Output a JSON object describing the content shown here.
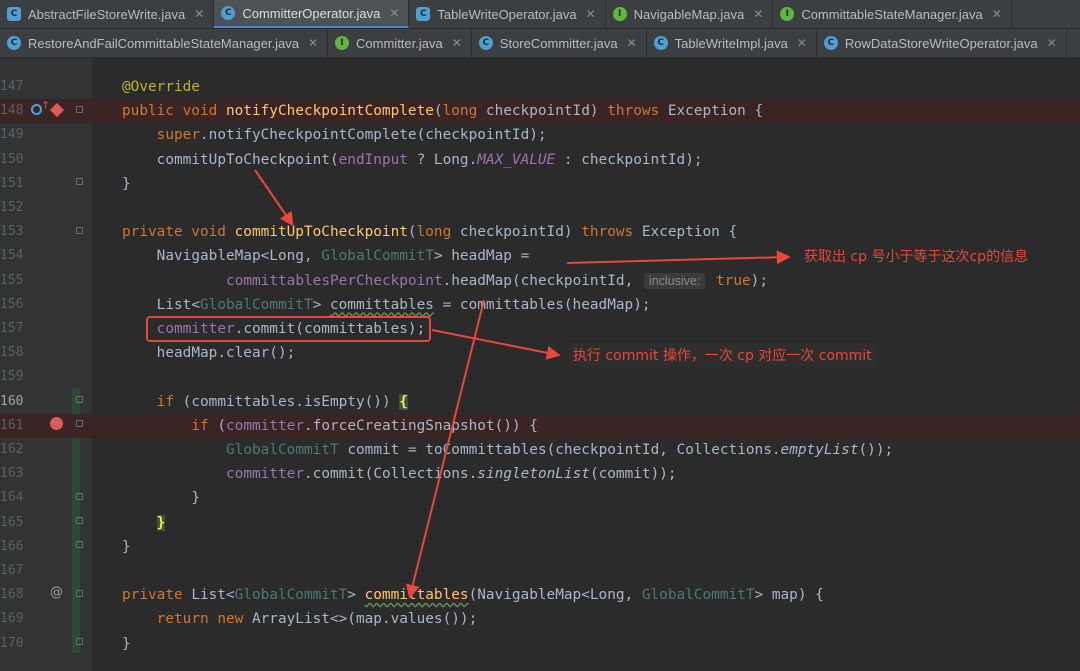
{
  "tabs_row1": [
    {
      "label": "AbstractFileStoreWrite.java",
      "icon": "abstract-class-icon",
      "kind": "abstract",
      "active": false
    },
    {
      "label": "CommitterOperator.java",
      "icon": "class-icon",
      "kind": "class",
      "active": true
    },
    {
      "label": "TableWriteOperator.java",
      "icon": "abstract-class-icon",
      "kind": "abstract",
      "active": false
    },
    {
      "label": "NavigableMap.java",
      "icon": "interface-icon",
      "kind": "iface",
      "active": false
    },
    {
      "label": "CommittableStateManager.java",
      "icon": "interface-icon",
      "kind": "iface",
      "active": false
    }
  ],
  "tabs_row2": [
    {
      "label": "RestoreAndFailCommittableStateManager.java",
      "icon": "class-icon",
      "kind": "class",
      "active": false
    },
    {
      "label": "Committer.java",
      "icon": "interface-icon",
      "kind": "iface",
      "active": false
    },
    {
      "label": "StoreCommitter.java",
      "icon": "class-icon",
      "kind": "class",
      "active": false
    },
    {
      "label": "TableWriteImpl.java",
      "icon": "class-icon",
      "kind": "class",
      "active": false
    },
    {
      "label": "RowDataStoreWriteOperator.java",
      "icon": "class-icon",
      "kind": "class",
      "active": false
    }
  ],
  "editor": {
    "lines": [
      {
        "n": "147",
        "indent": 0,
        "tokens": [
          {
            "t": "@Override",
            "c": "ann"
          }
        ]
      },
      {
        "n": "148",
        "indent": 0,
        "bp": true,
        "tokens": [
          {
            "t": "public void ",
            "c": "kw"
          },
          {
            "t": "notifyCheckpointComplete",
            "c": "fn"
          },
          {
            "t": "("
          },
          {
            "t": "long ",
            "c": "kw"
          },
          {
            "t": "checkpointId) "
          },
          {
            "t": "throws ",
            "c": "kw"
          },
          {
            "t": "Exception {"
          }
        ]
      },
      {
        "n": "149",
        "indent": 4,
        "tokens": [
          {
            "t": "super",
            "c": "kw"
          },
          {
            "t": ".notifyCheckpointComplete(checkpointId);"
          }
        ]
      },
      {
        "n": "150",
        "indent": 4,
        "tokens": [
          {
            "t": "commitUpToCheckpoint("
          },
          {
            "t": "endInput",
            "c": "fld"
          },
          {
            "t": " ? Long."
          },
          {
            "t": "MAX_VALUE",
            "c": "const"
          },
          {
            "t": " : checkpointId);"
          }
        ]
      },
      {
        "n": "151",
        "indent": 0,
        "tokens": [
          {
            "t": "}"
          }
        ]
      },
      {
        "n": "152",
        "indent": 0,
        "tokens": []
      },
      {
        "n": "153",
        "indent": 0,
        "tokens": [
          {
            "t": "private void ",
            "c": "kw"
          },
          {
            "t": "commitUpToCheckpoint",
            "c": "fn"
          },
          {
            "t": "("
          },
          {
            "t": "long ",
            "c": "kw"
          },
          {
            "t": "checkpointId) "
          },
          {
            "t": "throws ",
            "c": "kw"
          },
          {
            "t": "Exception {"
          }
        ]
      },
      {
        "n": "154",
        "indent": 4,
        "tokens": [
          {
            "t": "NavigableMap<Long, "
          },
          {
            "t": "GlobalCommitT",
            "c": "gen"
          },
          {
            "t": "> headMap ="
          }
        ]
      },
      {
        "n": "155",
        "indent": 12,
        "tokens": [
          {
            "t": "committablesPerCheckpoint",
            "c": "fld"
          },
          {
            "t": ".headMap(checkpointId, "
          },
          {
            "t": "inclusive:",
            "c": "hint"
          },
          {
            "t": " "
          },
          {
            "t": "true",
            "c": "kw"
          },
          {
            "t": ");"
          }
        ]
      },
      {
        "n": "156",
        "indent": 4,
        "tokens": [
          {
            "t": "List<"
          },
          {
            "t": "GlobalCommitT",
            "c": "gen"
          },
          {
            "t": "> "
          },
          {
            "t": "committables",
            "c": "wavy"
          },
          {
            "t": " = committables(headMap);"
          }
        ]
      },
      {
        "n": "157",
        "indent": 4,
        "tokens": [
          {
            "t": "committer",
            "c": "fld"
          },
          {
            "t": ".commit(committables);"
          }
        ]
      },
      {
        "n": "158",
        "indent": 4,
        "tokens": [
          {
            "t": "headMap.clear();"
          }
        ]
      },
      {
        "n": "159",
        "indent": 0,
        "tokens": []
      },
      {
        "n": "160",
        "indent": 4,
        "current": true,
        "tokens": [
          {
            "t": "if ",
            "c": "kw"
          },
          {
            "t": "(committables.isEmpty()) "
          },
          {
            "t": "{",
            "c": "brace-hl"
          }
        ]
      },
      {
        "n": "161",
        "indent": 8,
        "bp": true,
        "tokens": [
          {
            "t": "if ",
            "c": "kw"
          },
          {
            "t": "("
          },
          {
            "t": "committer",
            "c": "fld"
          },
          {
            "t": ".forceCreatingSnapshot()) {"
          }
        ]
      },
      {
        "n": "162",
        "indent": 12,
        "tokens": [
          {
            "t": "GlobalCommitT",
            "c": "gen"
          },
          {
            "t": " commit = toCommittables(checkpointId, Collections."
          },
          {
            "t": "emptyList",
            "c": "ital"
          },
          {
            "t": "());"
          }
        ]
      },
      {
        "n": "163",
        "indent": 12,
        "tokens": [
          {
            "t": "committer",
            "c": "fld"
          },
          {
            "t": ".commit(Collections."
          },
          {
            "t": "singletonList",
            "c": "ital"
          },
          {
            "t": "(commit));"
          }
        ]
      },
      {
        "n": "164",
        "indent": 8,
        "tokens": [
          {
            "t": "}"
          }
        ]
      },
      {
        "n": "165",
        "indent": 4,
        "tokens": [
          {
            "t": "}",
            "c": "brace-hl"
          }
        ]
      },
      {
        "n": "166",
        "indent": 0,
        "tokens": [
          {
            "t": "}"
          }
        ]
      },
      {
        "n": "167",
        "indent": 0,
        "tokens": []
      },
      {
        "n": "168",
        "indent": 0,
        "tokens": [
          {
            "t": "private ",
            "c": "kw"
          },
          {
            "t": "List<"
          },
          {
            "t": "GlobalCommitT",
            "c": "gen"
          },
          {
            "t": "> "
          },
          {
            "t": "committables",
            "c": "fn wavy"
          },
          {
            "t": "(NavigableMap<Long, "
          },
          {
            "t": "GlobalCommitT",
            "c": "gen"
          },
          {
            "t": "> map) {"
          }
        ]
      },
      {
        "n": "169",
        "indent": 4,
        "tokens": [
          {
            "t": "return new ",
            "c": "kw"
          },
          {
            "t": "ArrayList<>(map.values());"
          }
        ]
      },
      {
        "n": "170",
        "indent": 0,
        "tokens": [
          {
            "t": "}"
          }
        ]
      }
    ]
  },
  "annotations": {
    "note_headmap": "获取出 cp 号小于等于这次cp的信息",
    "note_commit": "执行 commit 操作，一次 cp 对应一次 commit"
  },
  "colors": {
    "annotation_red": "#e8473b",
    "breakpoint": "#db5c5c",
    "active_tab_underline": "#4a88c7"
  }
}
